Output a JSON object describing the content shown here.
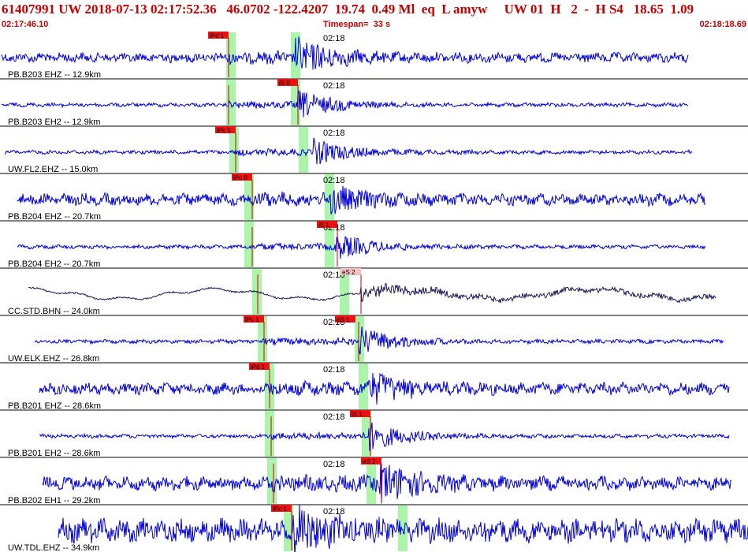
{
  "header": {
    "title": "61407991 UW 2018-07-13 02:17:52.36   46.0702 -122.4207  19.74  0.49 Ml  eq  L amyw     UW 01  H   2  -  H S4   18.65  1.09",
    "start_time": "02:17:46.10",
    "timespan": "Timespan=  33 s",
    "end_time": "02:18:18.69"
  },
  "colors": {
    "waveform": "#0000dd",
    "waveform_alt": "#1a1a55",
    "pick_bg": "#ee1111",
    "pick_alt_bg": "#f4c0c0",
    "window": "#aaf5aa",
    "separator": "#000000",
    "title": "#c80000"
  },
  "minute_label": "02:18",
  "traces": [
    {
      "label": "PB.B203 EHZ -- 12.9km",
      "pick": "iPd 1",
      "color": "#0000dd"
    },
    {
      "label": "PB.B203 EH2 -- 12.9km",
      "pick": "iS 0",
      "color": "#0000dd"
    },
    {
      "label": "UW.FL2.EHZ -- 15.0km",
      "pick": "iPc 1",
      "color": "#0000dd"
    },
    {
      "label": "PB.B204 EHZ -- 20.7km",
      "pick": "iPc 0",
      "color": "#0000dd"
    },
    {
      "label": "PB.B204 EH2 -- 20.7km",
      "pick": "iS 1",
      "color": "#0000dd"
    },
    {
      "label": "CC.STD.BHN -- 24.0km",
      "pick": "eS 2",
      "color": "#1a1a55"
    },
    {
      "label": "UW.ELK.EHZ -- 26.8km",
      "pick": "iPc 1",
      "pick2": "eS 1",
      "color": "#0000dd"
    },
    {
      "label": "PB.B201 EHZ -- 28.6km",
      "pick": "iPd 1",
      "color": "#0000dd"
    },
    {
      "label": "PB.B201 EH2 -- 28.6km",
      "pick": "iS 1",
      "color": "#0000dd"
    },
    {
      "label": "PB.B202 EH1 -- 29.2km",
      "pick": "eS 2",
      "color": "#0000dd"
    },
    {
      "label": "UW.TDL.EHZ -- 34.9km",
      "pick": "iPc 1",
      "color": "#0000dd"
    }
  ]
}
